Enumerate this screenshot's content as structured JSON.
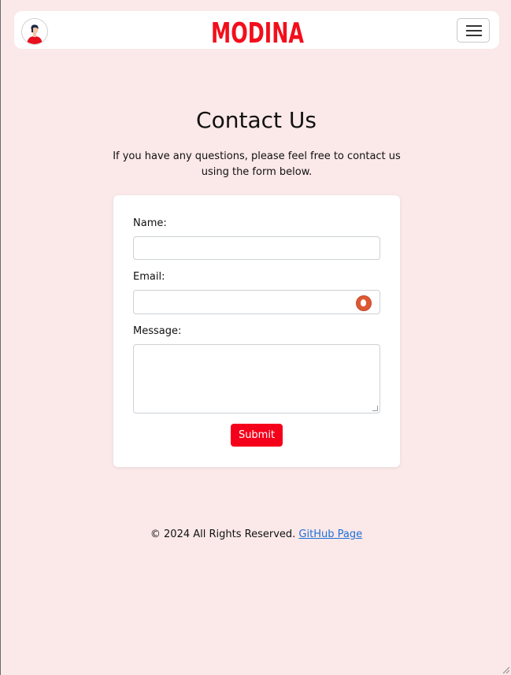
{
  "header": {
    "brand": "MODINA",
    "brand_color": "#f20f1c",
    "avatar_icon": "user-avatar-icon",
    "menu_icon": "hamburger-menu-icon"
  },
  "main": {
    "title": "Contact Us",
    "intro": "If you have any questions, please feel free to contact us using the form below."
  },
  "form": {
    "name_label": "Name:",
    "name_value": "",
    "email_label": "Email:",
    "email_value": "",
    "email_autofill_icon": "duckduckgo-icon",
    "message_label": "Message:",
    "message_value": "",
    "submit_label": "Submit",
    "submit_color": "#f5001a"
  },
  "footer": {
    "copyright": "© 2024 All Rights Reserved.",
    "link_text": "GitHub Page",
    "link_color": "#1f6fd6"
  },
  "colors": {
    "page_background": "#fbe8e8",
    "card_background": "#ffffff"
  }
}
